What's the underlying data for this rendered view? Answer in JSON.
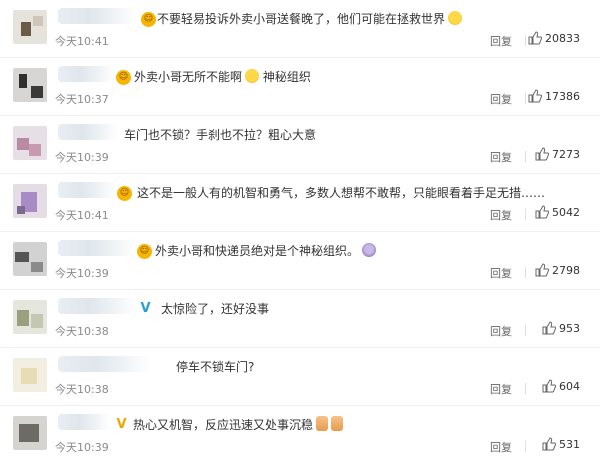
{
  "comments": [
    {
      "text": "不要轻易投诉外卖小哥送餐晚了，他们可能在拯救世界",
      "time": "今天10:41",
      "reply": "回复",
      "likes": "20833",
      "badge": "gold",
      "emojis": [
        "laugh-icon"
      ]
    },
    {
      "text": "外卖小哥无所不能啊",
      "text2": "神秘组织",
      "time": "今天10:37",
      "reply": "回复",
      "likes": "17386",
      "badge": "gold",
      "emojis": [
        "laugh-icon"
      ]
    },
    {
      "text": "车门也不锁？手刹也不拉？粗心大意",
      "time": "今天10:39",
      "reply": "回复",
      "likes": "7273",
      "badge": "",
      "emojis": []
    },
    {
      "text": "这不是一般人有的机智和勇气，多数人想帮不敢帮，只能眼看着手足无措……",
      "time": "今天10:41",
      "reply": "回复",
      "likes": "5042",
      "badge": "gold",
      "emojis": []
    },
    {
      "text": "外卖小哥和快递员绝对是个神秘组织。",
      "time": "今天10:39",
      "reply": "回复",
      "likes": "2798",
      "badge": "gold",
      "emojis": [
        "owl-icon"
      ]
    },
    {
      "text": "太惊险了，还好没事",
      "time": "今天10:38",
      "reply": "回复",
      "likes": "953",
      "badge": "vip",
      "emojis": []
    },
    {
      "text": "停车不锁车门?",
      "time": "今天10:38",
      "reply": "回复",
      "likes": "604",
      "badge": "",
      "emojis": []
    },
    {
      "text": "热心又机智，反应迅速又处事沉稳",
      "time": "今天10:39",
      "reply": "回复",
      "likes": "531",
      "badge": "vgold",
      "emojis": [
        "thumbs-up-icon",
        "thumbs-up-icon"
      ]
    }
  ],
  "badges": {
    "gold": "😊",
    "vip": "V",
    "vgold": "V"
  },
  "colors": {
    "time": "#8a8a8a",
    "badge_gold": "#f7b500",
    "badge_vip": "#2a9fd6",
    "badge_vgold": "#f0a500"
  },
  "icons": {
    "like": "thumbs-up-icon"
  }
}
